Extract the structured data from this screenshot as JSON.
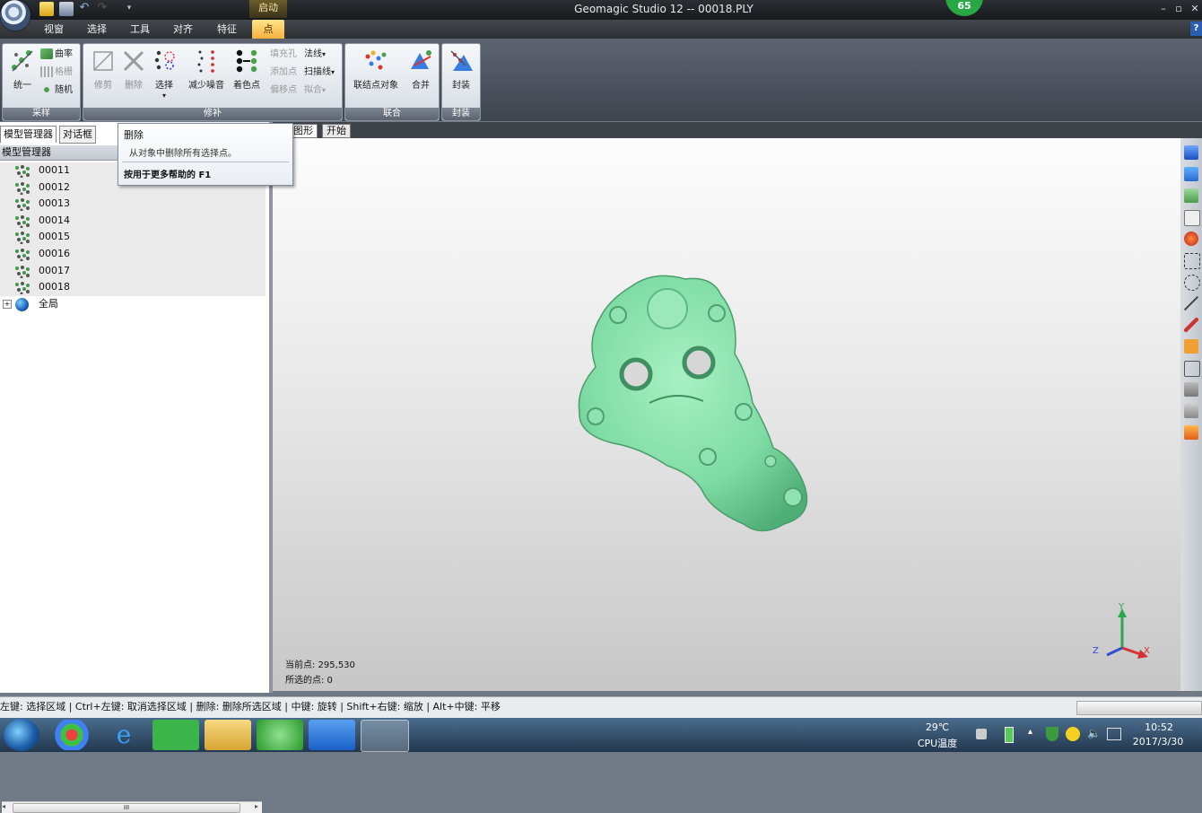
{
  "window": {
    "title": "Geomagic Studio 12 -- 00018.PLY",
    "context_tab": "启动",
    "badge": "65",
    "controls": {
      "minimize": "–",
      "maximize": "▫",
      "close": "✕"
    },
    "help": "?"
  },
  "ribbon": {
    "tabs": [
      {
        "label": "视窗"
      },
      {
        "label": "选择"
      },
      {
        "label": "工具"
      },
      {
        "label": "对齐"
      },
      {
        "label": "特征"
      },
      {
        "label": "点",
        "active": true
      }
    ],
    "groups": {
      "sampling": {
        "label": "采样",
        "unify": "统一",
        "curvature": "曲率",
        "grid": "格栅",
        "random": "随机"
      },
      "repair": {
        "label": "修补",
        "trim": "修剪",
        "delete": "删除",
        "select": "选择",
        "reduce_noise": "减少噪音",
        "color_points": "着色点",
        "fill_holes": "填充孔",
        "add_points": "添加点",
        "offset_points": "偏移点",
        "normals": "法线",
        "scan_lines": "扫描线",
        "fit": "拟合"
      },
      "combine": {
        "label": "联合",
        "join_objects": "联结点对象",
        "merge": "合并"
      },
      "wrap": {
        "label": "封装",
        "wrap": "封装"
      }
    }
  },
  "left_panel": {
    "tabs": [
      "模型管理器",
      "对话框"
    ],
    "header": "模型管理器",
    "items": [
      "00011",
      "00012",
      "00013",
      "00014",
      "00015",
      "00016",
      "00017",
      "00018"
    ],
    "global": "全局",
    "expand": "+",
    "scroll_thumb": "III"
  },
  "tooltip": {
    "title": "删除",
    "description": "从对象中删除所有选择点。",
    "help": "按用于更多帮助的 F1"
  },
  "viewport": {
    "tabs": [
      "图形",
      "开始"
    ],
    "current_points_label": "当前点: 295,530",
    "selected_points_label": "所选的点: 0",
    "axes": {
      "x": "X",
      "y": "Y",
      "z": "Z"
    }
  },
  "status_bar": {
    "text": "左键: 选择区域 | Ctrl+左键: 取消选择区域 | 删除: 删除所选区域 | 中键: 旋转 | Shift+右键: 缩放 | Alt+中键: 平移"
  },
  "taskbar": {
    "temperature": "29℃",
    "cpu_label": "CPU温度",
    "time": "10:52",
    "date": "2017/3/30"
  },
  "colors": {
    "model_green": "#7fdca4",
    "active_tab": "#f6b23c",
    "viewport_top": "#fdfdfd",
    "viewport_bottom": "#c7c7c7"
  }
}
